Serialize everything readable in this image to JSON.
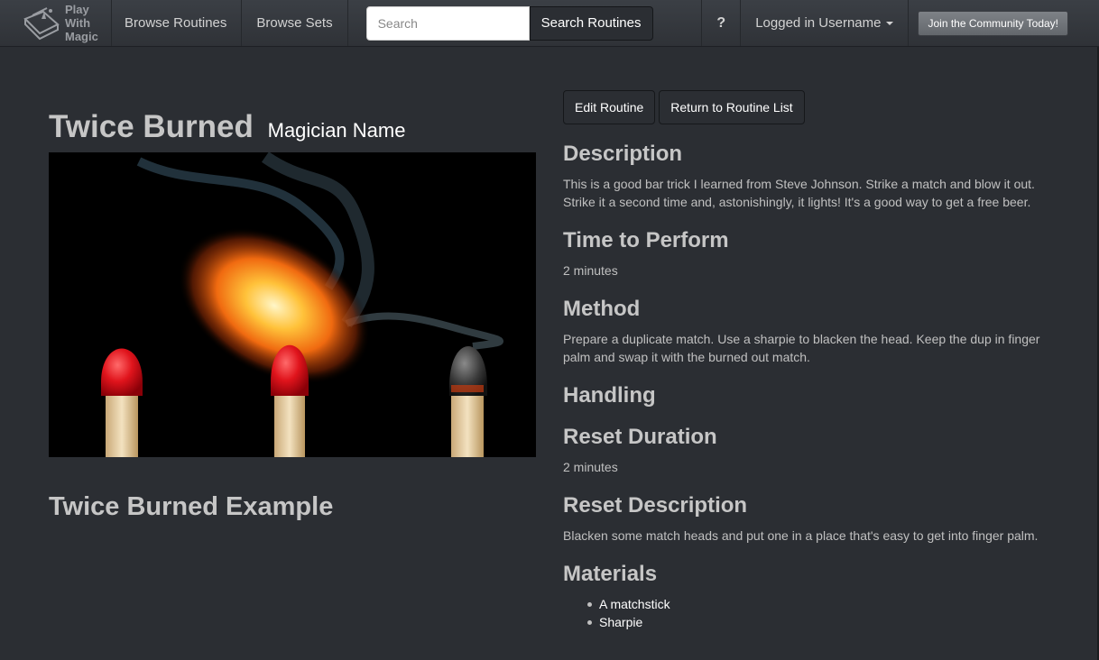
{
  "nav": {
    "brand": [
      "Play",
      "With",
      "Magic"
    ],
    "links": [
      "Browse Routines",
      "Browse Sets"
    ],
    "search_placeholder": "Search",
    "search_button": "Search Routines",
    "help": "?",
    "user": "Logged in Username",
    "join": "Join the Community Today!"
  },
  "routine": {
    "title": "Twice Burned",
    "magician": "Magician Name",
    "example_title": "Twice Burned Example"
  },
  "actions": {
    "edit": "Edit Routine",
    "return": "Return to Routine List"
  },
  "sections": {
    "description_h": "Description",
    "description_line1": "This is a good bar trick I learned from Steve Johnson. Strike a match and blow it out.",
    "description_line2": "Strike it a second time and, astonishingly, it lights! It's a good way to get a free beer.",
    "time_h": "Time to Perform",
    "time": "2 minutes",
    "method_h": "Method",
    "method_line1": "Prepare a duplicate match. Use a sharpie to blacken the head. Keep the dup in finger",
    "method_line2": "palm and swap it with the burned out match.",
    "handling_h": "Handling",
    "reset_duration_h": "Reset Duration",
    "reset_duration": "2 minutes",
    "reset_description_h": "Reset Description",
    "reset_description": "Blacken some match heads and put one in a place that's easy to get into finger palm.",
    "materials_h": "Materials",
    "materials": [
      "A matchstick",
      "Sharpie"
    ]
  },
  "colors": {
    "background": "#2b2e33",
    "navbar": "#3b3f45",
    "heading": "#c6c6c6"
  }
}
